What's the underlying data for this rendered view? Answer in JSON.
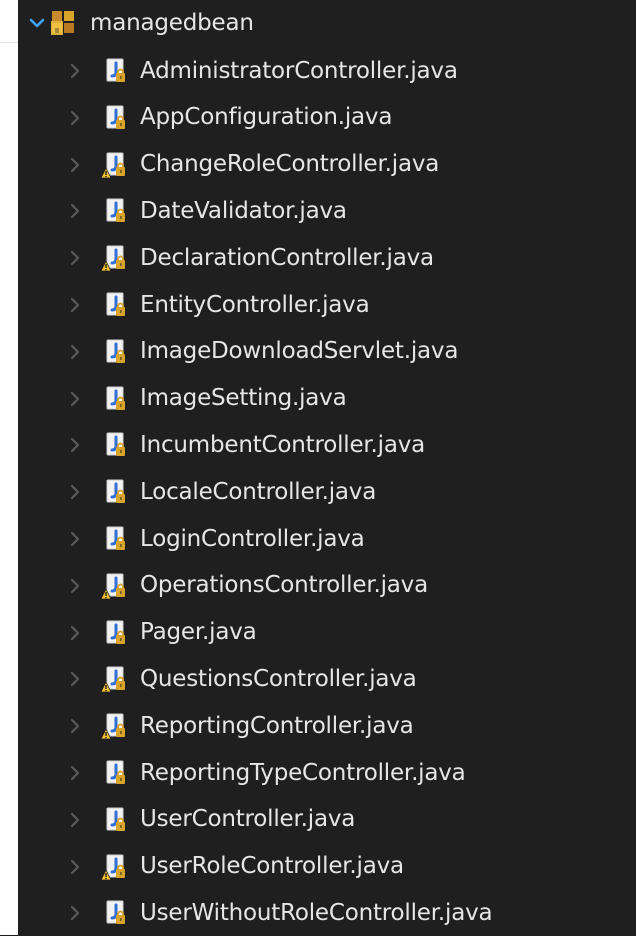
{
  "package": {
    "label": "managedbean",
    "icon": "package-icon"
  },
  "files": [
    {
      "name": "AdministratorController.java",
      "variant": "plain"
    },
    {
      "name": "AppConfiguration.java",
      "variant": "plain"
    },
    {
      "name": "ChangeRoleController.java",
      "variant": "warning"
    },
    {
      "name": "DateValidator.java",
      "variant": "plain"
    },
    {
      "name": "DeclarationController.java",
      "variant": "warning"
    },
    {
      "name": "EntityController.java",
      "variant": "plain"
    },
    {
      "name": "ImageDownloadServlet.java",
      "variant": "plain"
    },
    {
      "name": "ImageSetting.java",
      "variant": "plain"
    },
    {
      "name": "IncumbentController.java",
      "variant": "plain"
    },
    {
      "name": "LocaleController.java",
      "variant": "plain"
    },
    {
      "name": "LoginController.java",
      "variant": "plain"
    },
    {
      "name": "OperationsController.java",
      "variant": "warning"
    },
    {
      "name": "Pager.java",
      "variant": "plain"
    },
    {
      "name": "QuestionsController.java",
      "variant": "warning"
    },
    {
      "name": "ReportingController.java",
      "variant": "warning"
    },
    {
      "name": "ReportingTypeController.java",
      "variant": "plain"
    },
    {
      "name": "UserController.java",
      "variant": "plain"
    },
    {
      "name": "UserRoleController.java",
      "variant": "warning"
    },
    {
      "name": "UserWithoutRoleController.java",
      "variant": "plain"
    }
  ],
  "colors": {
    "background": "#1f1f1f",
    "text": "#e6e6e6",
    "chevron_open": "#3ea6ff",
    "chevron_closed": "#5a5a5a",
    "file_blue": "#2f6fd6",
    "file_paper": "#f2f2f2",
    "lock_gold": "#d9a42a",
    "warning_yellow": "#f4c430"
  }
}
